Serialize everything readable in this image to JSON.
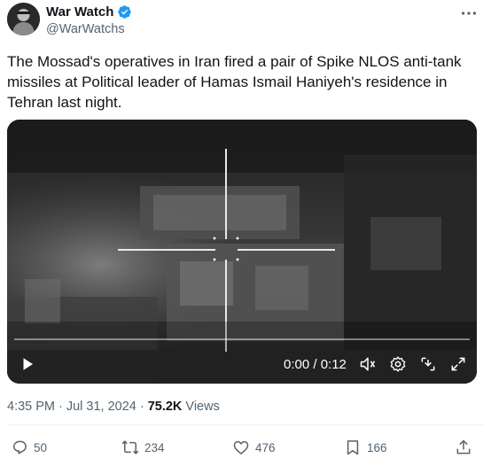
{
  "author": {
    "display_name": "War Watch",
    "handle": "@WarWatchs",
    "verified": true
  },
  "tweet": {
    "text": "The Mossad's operatives in Iran fired a pair of Spike NLOS anti-tank missiles at Political leader of Hamas Ismail Haniyeh's residence in Tehran last night."
  },
  "video": {
    "time": "0:00 / 0:12",
    "progress_fraction": 0.0
  },
  "meta": {
    "time": "4:35 PM",
    "sep1": "·",
    "date": "Jul 31, 2024",
    "sep2": "·",
    "views_count": "75.2K",
    "views_label": "Views"
  },
  "actions": {
    "reply_count": "50",
    "repost_count": "234",
    "like_count": "476",
    "bookmark_count": "166"
  },
  "colors": {
    "accent": "#1d9bf0",
    "muted": "#536471",
    "text": "#0f1419"
  },
  "icons": [
    "verified-badge-icon",
    "more-icon",
    "play-icon",
    "volume-icon",
    "settings-icon",
    "captions-icon",
    "fullscreen-icon",
    "reply-icon",
    "repost-icon",
    "like-icon",
    "bookmark-icon",
    "share-icon"
  ]
}
